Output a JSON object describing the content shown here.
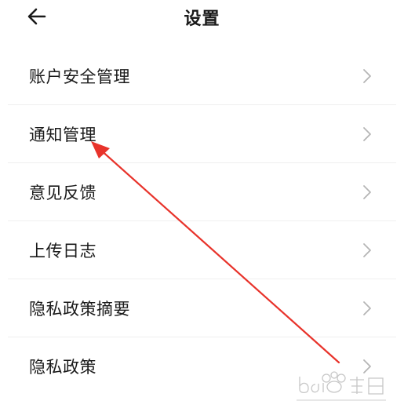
{
  "header": {
    "title": "设置",
    "back_icon": "arrow-left-icon"
  },
  "menu": {
    "items": [
      {
        "label": "账户安全管理"
      },
      {
        "label": "通知管理"
      },
      {
        "label": "意见反馈"
      },
      {
        "label": "上传日志"
      },
      {
        "label": "隐私政策摘要"
      },
      {
        "label": "隐私政策"
      }
    ],
    "chevron_icon": "chevron-right-icon"
  },
  "colors": {
    "text": "#1a1a1a",
    "chevron": "#b5b5b5",
    "divider": "#efefef",
    "annotation_arrow": "#e8332b"
  }
}
